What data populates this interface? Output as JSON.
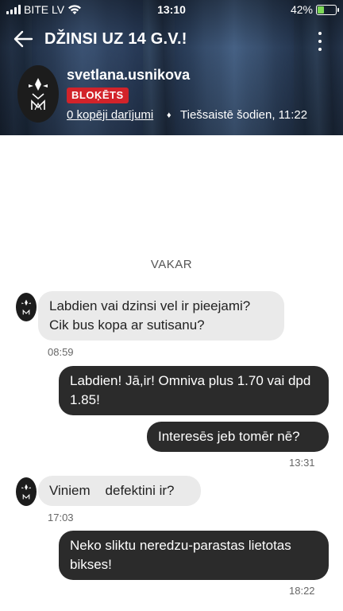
{
  "status_bar": {
    "carrier": "BITE LV",
    "time": "13:10",
    "battery_percent": "42%",
    "battery_level": 0.42,
    "wifi_icon": "wifi-icon",
    "battery_color": "#7ed957"
  },
  "header": {
    "title": "DŽINSI UZ 14 G.V.!",
    "back_icon": "back-arrow-icon",
    "menu_icon": "more-vertical-icon"
  },
  "profile": {
    "username": "svetlana.usnikova",
    "badge": "BLOĶĒTS",
    "badge_color": "#d2232a",
    "deals_link": "0 kopēji darījumi",
    "separator": "♦",
    "online_status": "Tiešsaistē šodien, 11:22"
  },
  "chat": {
    "day_separator": "VAKAR",
    "messages": [
      {
        "direction": "in",
        "text": "Labdien vai dzinsi vel ir pieejami? Cik bus kopa ar sutisanu?",
        "time": "08:59"
      },
      {
        "direction": "out",
        "text": "Labdien! Jā,ir! Omniva plus 1.70 vai dpd 1.85!",
        "time": ""
      },
      {
        "direction": "out",
        "text": "Interesēs jeb tomēr nē?",
        "time": "13:31"
      },
      {
        "direction": "in",
        "text": "Viniem    defektini ir?",
        "time": "17:03"
      },
      {
        "direction": "out",
        "text": "Neko sliktu neredzu-parastas lietotas bikses!",
        "time": "18:22"
      }
    ]
  }
}
